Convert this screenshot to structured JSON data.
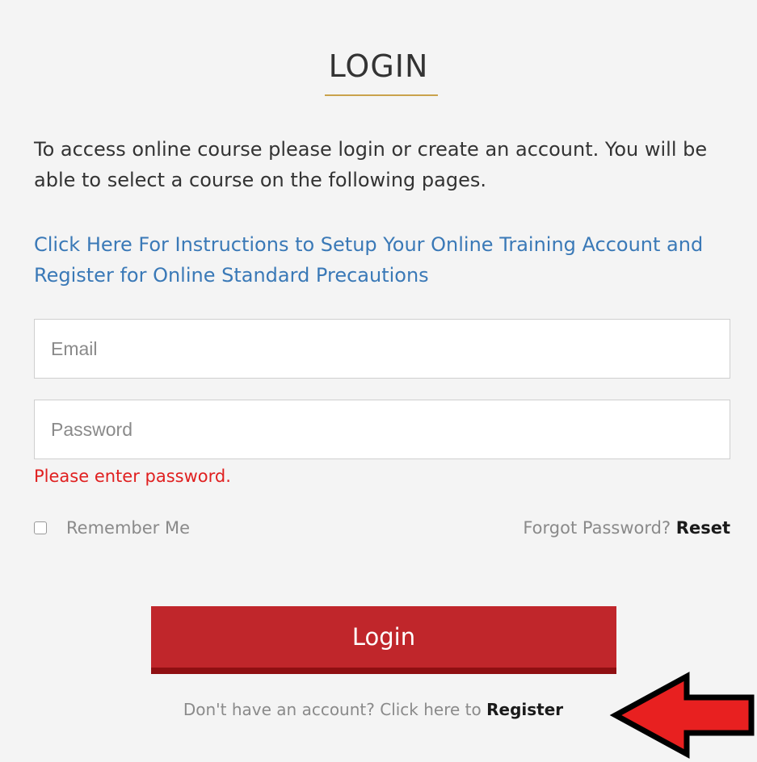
{
  "header": {
    "title": "LOGIN"
  },
  "intro_text": "To access online course please login or create an account. You will be able to select a course on the following pages.",
  "instructions_link": "Click Here For Instructions to Setup Your Online Training Account and Register for Online Standard Precautions",
  "form": {
    "email_placeholder": "Email",
    "email_value": "",
    "password_placeholder": "Password",
    "password_value": "",
    "password_error": "Please enter password.",
    "remember_label": "Remember Me",
    "remember_checked": false,
    "forgot_text": "Forgot Password?",
    "reset_label": "Reset",
    "login_label": "Login"
  },
  "register": {
    "prompt": "Don't have an account? Click here to",
    "link_label": "Register"
  },
  "colors": {
    "accent_underline": "#c9a24c",
    "link_blue": "#3a79b7",
    "error_red": "#e02020",
    "button_red": "#c0262b",
    "annotation_arrow": "#e82020"
  },
  "annotation": {
    "icon": "left-arrow-icon"
  }
}
